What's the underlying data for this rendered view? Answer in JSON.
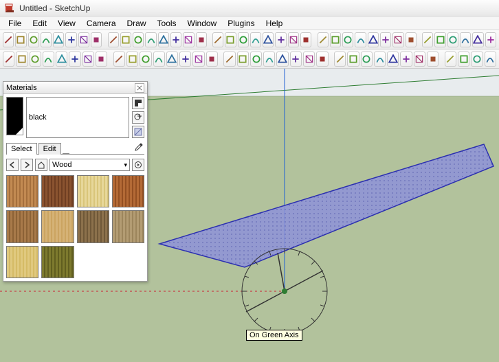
{
  "window": {
    "title": "Untitled - SketchUp"
  },
  "menus": [
    "File",
    "Edit",
    "View",
    "Camera",
    "Draw",
    "Tools",
    "Window",
    "Plugins",
    "Help"
  ],
  "materials_panel": {
    "title": "Materials",
    "name_field": "black",
    "tabs": {
      "select": "Select",
      "edit": "Edit"
    },
    "folder": "Wood",
    "swatches": [
      {
        "name": "wood-1",
        "c1": "#c28a52",
        "c2": "#a56f3c"
      },
      {
        "name": "wood-2",
        "c1": "#8a5330",
        "c2": "#6f3e22"
      },
      {
        "name": "wood-3",
        "c1": "#e7d79a",
        "c2": "#d9c57a"
      },
      {
        "name": "wood-4",
        "c1": "#b46a36",
        "c2": "#934f22"
      },
      {
        "name": "wood-5",
        "c1": "#a87a4a",
        "c2": "#8c6236"
      },
      {
        "name": "wood-6",
        "c1": "#d5b276",
        "c2": "#cba461"
      },
      {
        "name": "wood-7",
        "c1": "#8c714c",
        "c2": "#6f5838"
      },
      {
        "name": "wood-8",
        "c1": "#b39c73",
        "c2": "#9c855c"
      },
      {
        "name": "wood-9",
        "c1": "#e0c97f",
        "c2": "#d5bb66"
      },
      {
        "name": "wood-10",
        "c1": "#7d7a2e",
        "c2": "#605e1f"
      }
    ]
  },
  "viewport": {
    "tooltip_text": "On Green Axis"
  },
  "toolbar_icons_row1": [
    "select",
    "eraser",
    "line",
    "arc",
    "rectangle",
    "circle",
    "polygon",
    "freehand",
    "push-pull",
    "move",
    "rotate",
    "scale",
    "offset",
    "tape",
    "protractor",
    "dimension",
    "text",
    "axes",
    "section",
    "orbit",
    "pan",
    "zoom",
    "zoom-extents",
    "zoom-window",
    "previous",
    "next",
    "iso",
    "top",
    "front",
    "right",
    "back",
    "left",
    "shadows",
    "xray",
    "shaded",
    "paint",
    "3d-text",
    "add-loc"
  ],
  "toolbar_icons_row2": [
    "layer",
    "outliner",
    "entity",
    "model",
    "components",
    "styles",
    "scenes",
    "materials",
    "color",
    "sandbox-grid",
    "sandbox-stamp",
    "sandbox-drape",
    "sandbox-smoove",
    "solid-union",
    "solid-subtract",
    "solid-intersect",
    "solid-split",
    "solid-trim",
    "box",
    "cylinder",
    "cone",
    "sphere",
    "torus",
    "prism",
    "tube",
    "dome",
    "pyramid",
    "plugin-1",
    "plugin-2",
    "plugin-3",
    "plugin-4",
    "plugin-5",
    "plugin-6",
    "plugin-7",
    "plugin-8",
    "plugin-9"
  ]
}
